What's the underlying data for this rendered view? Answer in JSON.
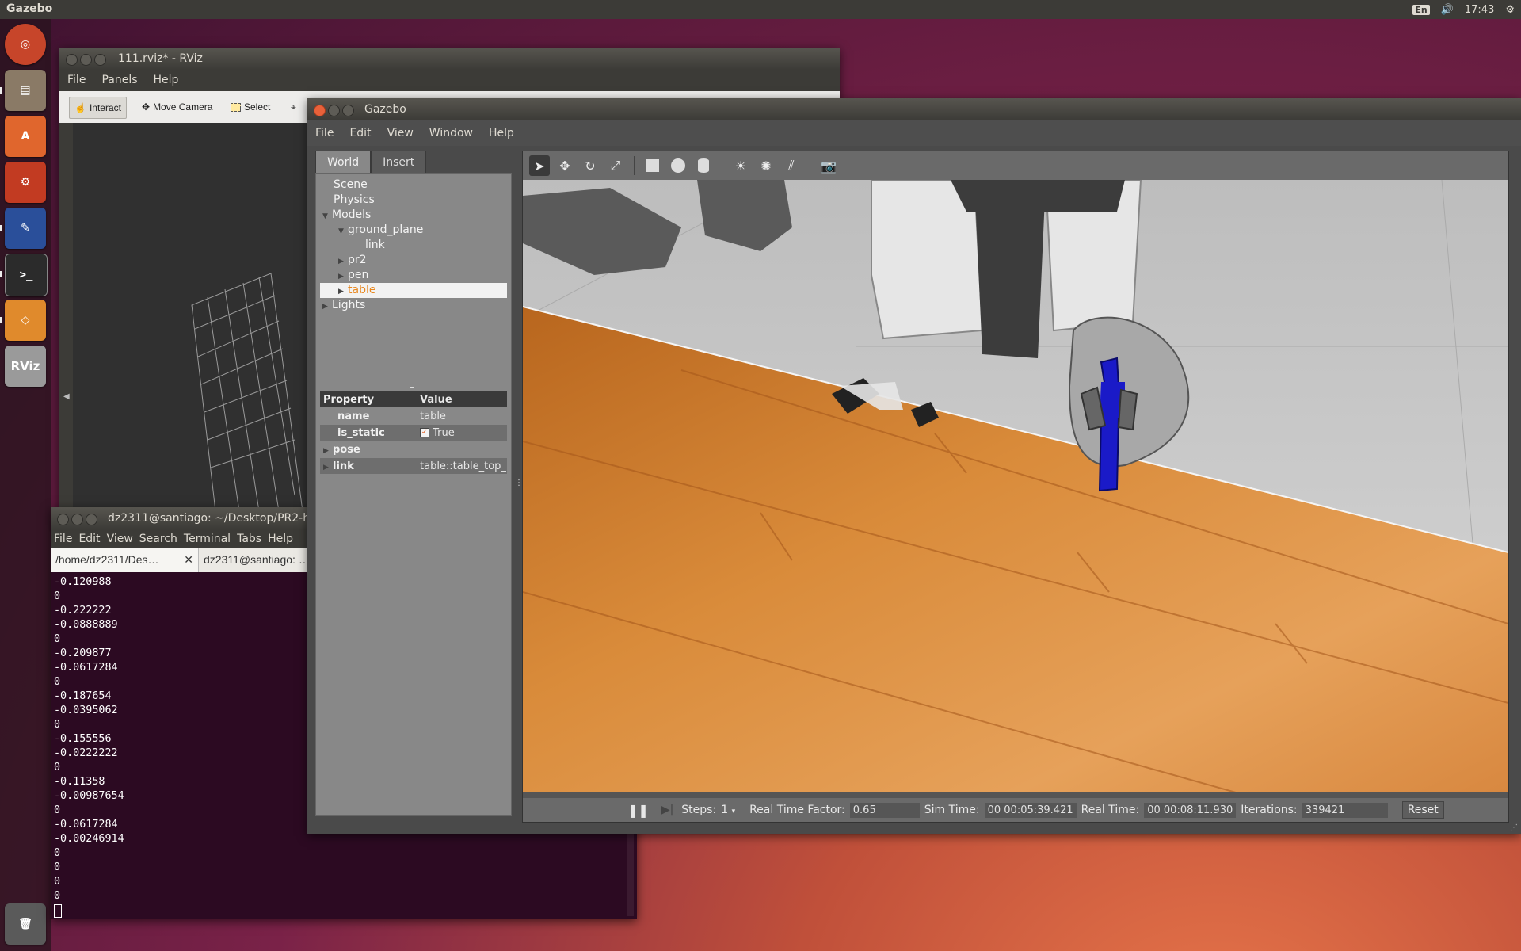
{
  "top_panel": {
    "app_title": "Gazebo",
    "keyboard": "En",
    "clock": "17:43"
  },
  "launcher": {
    "items": [
      "ubuntu-home-icon",
      "files-icon",
      "software-center-icon",
      "settings-icon",
      "text-editor-icon",
      "terminal-icon",
      "sublime-icon",
      "rviz-icon",
      "trash-icon"
    ],
    "terminal_glyph": ">_",
    "rviz_label": "RViz"
  },
  "rviz": {
    "title": "111.rviz* - RViz",
    "menu": [
      "File",
      "Panels",
      "Help"
    ],
    "tools": {
      "interact": "Interact",
      "move_camera": "Move Camera",
      "select": "Select"
    }
  },
  "terminal": {
    "title": "dz2311@santiago: ~/Desktop/PR2-h",
    "menu": [
      "File",
      "Edit",
      "View",
      "Search",
      "Terminal",
      "Tabs",
      "Help"
    ],
    "tabs": [
      "/home/dz2311/Des…",
      "dz2311@santiago: …"
    ],
    "lines": [
      "-0.120988",
      "0",
      "-0.222222",
      "-0.0888889",
      "0",
      "-0.209877",
      "-0.0617284",
      "0",
      "-0.187654",
      "-0.0395062",
      "0",
      "-0.155556",
      "-0.0222222",
      "0",
      "-0.11358",
      "-0.00987654",
      "0",
      "-0.0617284",
      "-0.00246914",
      "0",
      "0",
      "0",
      "0"
    ]
  },
  "gazebo": {
    "title": "Gazebo",
    "menu": [
      "File",
      "Edit",
      "View",
      "Window",
      "Help"
    ],
    "tabs": {
      "world": "World",
      "insert": "Insert"
    },
    "tree": {
      "scene": "Scene",
      "physics": "Physics",
      "models": "Models",
      "ground_plane": "ground_plane",
      "link": "link",
      "pr2": "pr2",
      "pen": "pen",
      "table": "table",
      "lights": "Lights"
    },
    "props": {
      "header_property": "Property",
      "header_value": "Value",
      "name_key": "name",
      "name_val": "table",
      "static_key": "is_static",
      "static_val": "True",
      "pose_key": "pose",
      "link_key": "link",
      "link_val": "table::table_top_…"
    },
    "status": {
      "steps_label": "Steps:",
      "steps_value": "1",
      "rtf_label": "Real Time Factor:",
      "rtf_value": "0.65",
      "sim_label": "Sim Time:",
      "sim_value": "00 00:05:39.421",
      "real_label": "Real Time:",
      "real_value": "00 00:08:11.930",
      "iter_label": "Iterations:",
      "iter_value": "339421",
      "reset": "Reset"
    }
  }
}
